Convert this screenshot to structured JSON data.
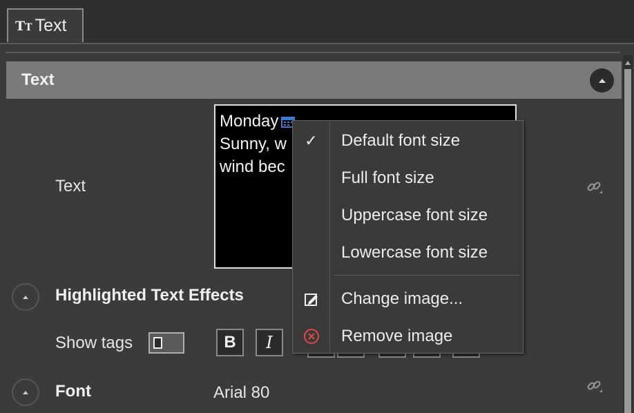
{
  "tab": {
    "icon": "text-size-icon",
    "icon_glyph": "Tт",
    "label": "Text"
  },
  "panel": {
    "title": "Text"
  },
  "text_field": {
    "label": "Text",
    "lines": [
      "Monday",
      "Sunny, w",
      "wind bec"
    ]
  },
  "highlighted_text_effects": {
    "label": "Highlighted Text Effects"
  },
  "show_tags": {
    "label": "Show tags",
    "on": false
  },
  "format_buttons": {
    "bold": "B",
    "italic": "I"
  },
  "font": {
    "label": "Font",
    "value": "Arial 80"
  },
  "context_menu": {
    "items": [
      {
        "label": "Default font size",
        "icon": "checkmark-icon",
        "checked": true
      },
      {
        "label": "Full font size"
      },
      {
        "label": "Uppercase font size"
      },
      {
        "label": "Lowercase font size"
      },
      {
        "label": "Change image...",
        "icon": "edit-image-icon"
      },
      {
        "label": "Remove image",
        "icon": "remove-circle-icon"
      }
    ]
  },
  "colors": {
    "accent_blue": "#3a7bd5",
    "remove_red": "#e04848"
  }
}
